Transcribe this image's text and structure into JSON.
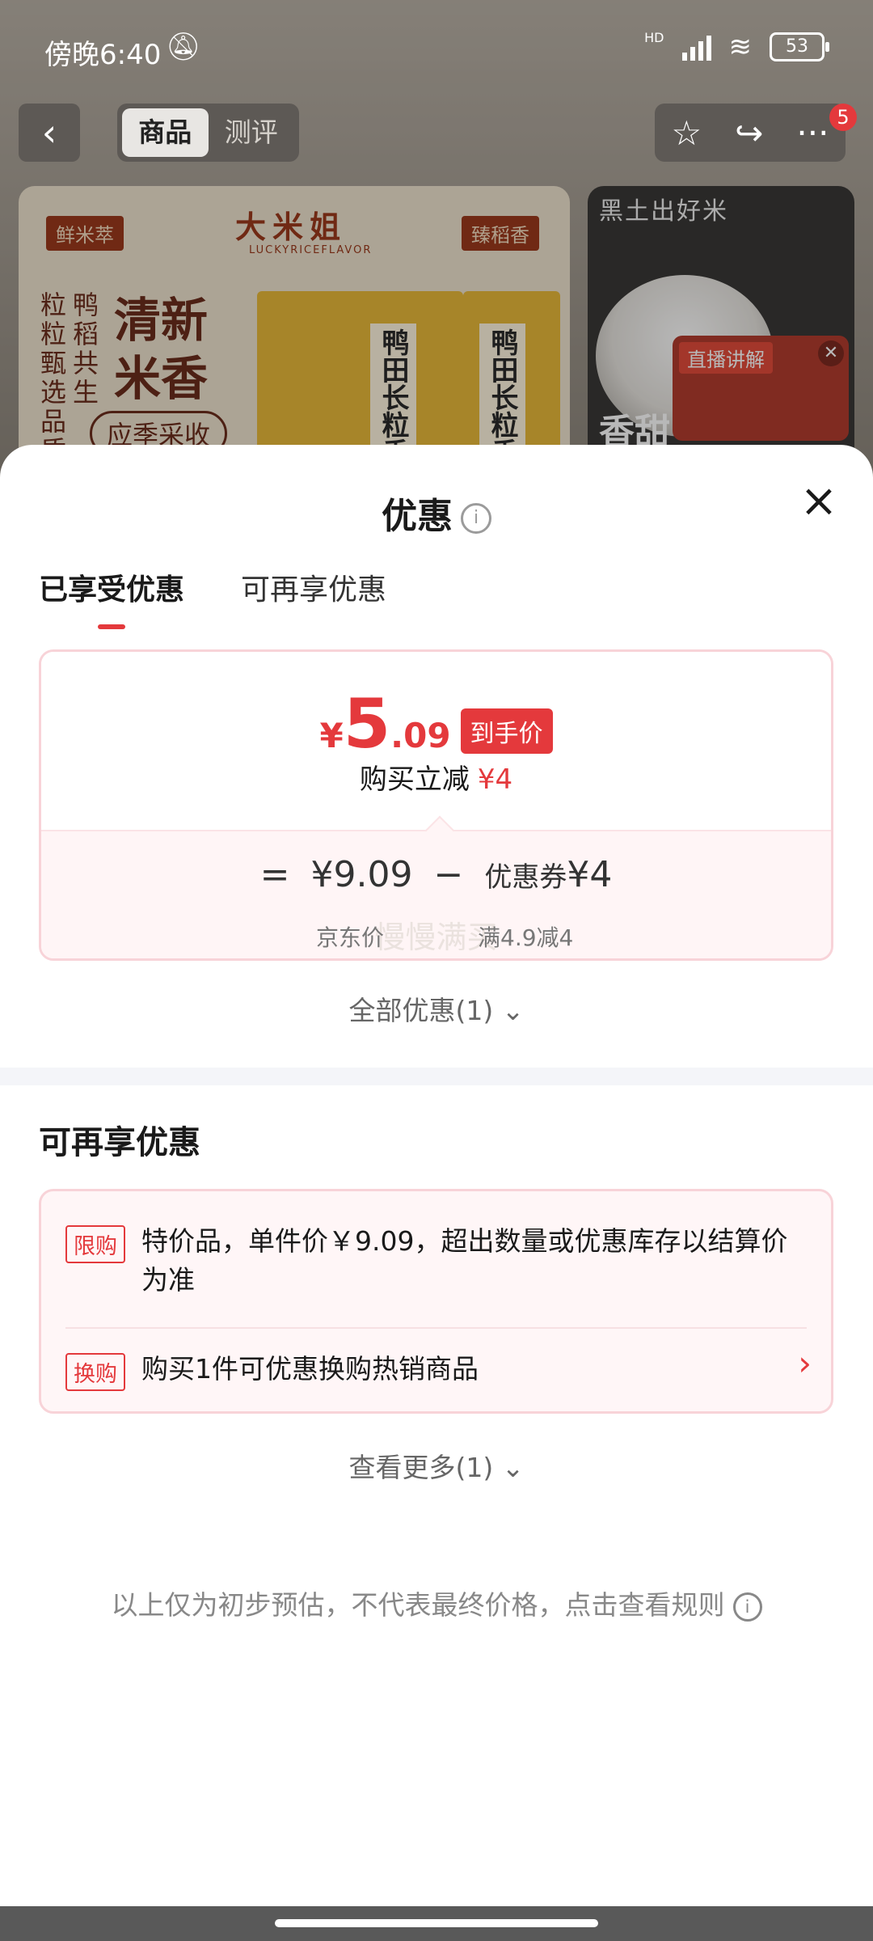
{
  "status_bar": {
    "time": "傍晚6:40",
    "network": "HD",
    "battery": "53"
  },
  "top_nav": {
    "tabs": [
      {
        "label": "商品",
        "active": true
      },
      {
        "label": "测评",
        "active": false
      }
    ],
    "badge_count": "5"
  },
  "banner": {
    "tag_left": "鲜米萃",
    "tag_right": "臻稻香",
    "brand": "大米姐",
    "brand_sub": "LUCKYRICEFLAVOR",
    "vertical_text_1": "鸭稻共生",
    "vertical_text_2": "粒粒甄选品质",
    "headline": "清新米香",
    "pill": "应季采收",
    "bag_label": "鸭田长粒香",
    "right_headline": "黑土出好米",
    "right_sub": "香甜",
    "live_label": "直播讲解"
  },
  "sheet": {
    "title": "优惠",
    "tabs": [
      {
        "label": "已享受优惠",
        "active": true
      },
      {
        "label": "可再享优惠",
        "active": false
      }
    ],
    "price_card": {
      "currency": "¥",
      "price_int": "5",
      "price_dec": ".09",
      "price_tag": "到手价",
      "saving_label": "购买立减",
      "saving_amount": "¥4",
      "equals": "=",
      "base_price": "¥9.09",
      "minus": "−",
      "coupon_label": "优惠券",
      "coupon_amount": "¥4",
      "base_price_label": "京东价",
      "coupon_rule": "满4.9减4",
      "watermark": "慢慢满买"
    },
    "all_discounts": "全部优惠(1)",
    "more_section_title": "可再享优惠",
    "offers": [
      {
        "tag": "限购",
        "text": "特价品，单件价￥9.09，超出数量或优惠库存以结算价为准"
      },
      {
        "tag": "换购",
        "text": "购买1件可优惠换购热销商品"
      }
    ],
    "see_more": "查看更多(1)",
    "disclaimer": "以上仅为初步预估，不代表最终价格，点击查看规则"
  },
  "colors": {
    "accent_red": "#e4393c",
    "card_border": "#f8d3d8",
    "card_bg_tint": "#fff5f6"
  }
}
